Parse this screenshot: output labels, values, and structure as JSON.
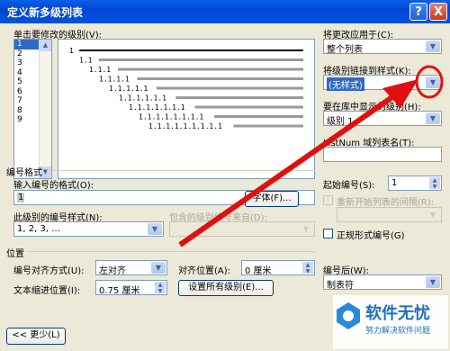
{
  "title": "定义新多级列表",
  "title_help": "?",
  "title_close": "X",
  "level_prompt": "单击要修改的级别(V):",
  "levels": [
    "1",
    "2",
    "3",
    "4",
    "5",
    "6",
    "7",
    "8",
    "9"
  ],
  "preview_labels": [
    "1",
    "1.1",
    "1.1.1",
    "1.1.1.1",
    "1.1.1.1.1",
    "1.1.1.1.1.1",
    "1.1.1.1.1.1.1",
    "1.1.1.1.1.1.1.1",
    "1.1.1.1.1.1.1.1.1"
  ],
  "apply_to": {
    "label": "将更改应用于(C):",
    "value": "整个列表"
  },
  "link_style": {
    "label": "将级别链接到样式(K):",
    "value": "(无样式)"
  },
  "gallery_level": {
    "label": "要在库中显示的级别(H):",
    "value": "级别 1"
  },
  "listnum": {
    "label": "ListNum 域列表名(T):",
    "value": ""
  },
  "number_format_section": "编号格式",
  "enter_format": {
    "label": "输入编号的格式(O):",
    "value": "1"
  },
  "font_button": "字体(F)...",
  "number_style": {
    "label": "此级别的编号样式(N):",
    "value": "1, 2, 3, …"
  },
  "include_level": {
    "label": "包含的级别编号来自(D):",
    "value": ""
  },
  "start_at": {
    "label": "起始编号(S):",
    "value": "1"
  },
  "restart_list": {
    "label": "重新开始列表的间隔(R):",
    "value": ""
  },
  "legal_style": "正规形式编号(G)",
  "position_section": "位置",
  "alignment": {
    "label": "编号对齐方式(U):",
    "value": "左对齐"
  },
  "align_at": {
    "label": "对齐位置(A):",
    "value": "0 厘米"
  },
  "indent_at": {
    "label": "文本缩进位置(I):",
    "value": "0.75 厘米"
  },
  "set_all_button": "设置所有级别(E)...",
  "follow_with": {
    "label": "编号后(W):",
    "value": "制表符"
  },
  "less_button": "<< 更少(L)",
  "watermark": {
    "title": "软件无忧",
    "subtitle": "努力解决软件问题"
  },
  "colors": {
    "annotation": "#e01010",
    "accent": "#316ac5"
  }
}
